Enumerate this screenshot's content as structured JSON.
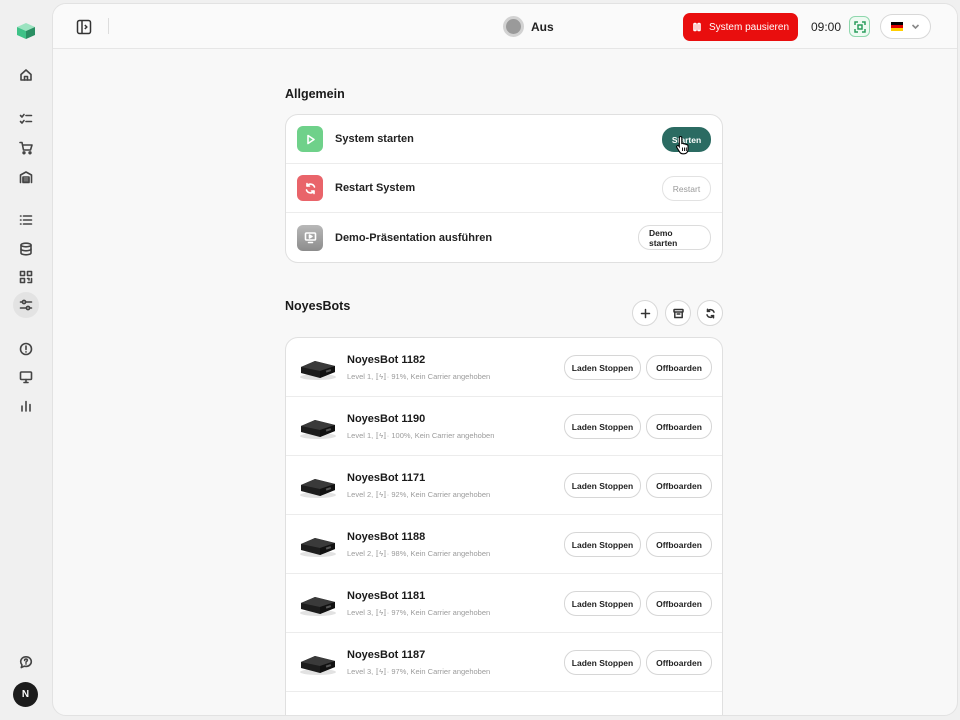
{
  "sidebar": {
    "icons": [
      "home-icon",
      "checklist-icon",
      "cart-icon",
      "warehouse-icon",
      "list-icon",
      "database-icon",
      "qr-code-icon",
      "sliders-icon",
      "alert-circle-icon",
      "monitor-icon",
      "bar-chart-icon",
      "help-icon"
    ],
    "active": "sliders-icon",
    "avatar_initial": "N"
  },
  "header": {
    "status_label": "Aus",
    "pause_button_label": "System pausieren",
    "time": "09:00",
    "language_flag": "de-flag-icon",
    "colors": {
      "pause": "#e90e0e",
      "status_dot": "#9a9a9a",
      "scan": "#2a9d5c"
    }
  },
  "general": {
    "title": "Allgemein",
    "items": [
      {
        "label": "System starten",
        "icon": "play-icon",
        "icon_color": "#6fd18a",
        "button": "Starten",
        "button_state": "primary"
      },
      {
        "label": "Restart System",
        "icon": "refresh-icon",
        "icon_color": "#e9646a",
        "button": "Restart",
        "button_state": "disabled"
      },
      {
        "label": "Demo-Präsentation ausführen",
        "icon": "presentation-icon",
        "icon_color": "#9e9e9e",
        "button": "Demo starten",
        "button_state": "default"
      }
    ]
  },
  "bots": {
    "title": "NoyesBots",
    "actions": [
      "plus-icon",
      "archive-icon",
      "refresh-icon"
    ],
    "stop_label": "Laden Stoppen",
    "offboard_label": "Offboarden",
    "items": [
      {
        "name": "NoyesBot 1182",
        "level": "Level 1,",
        "battery": "91%, Kein Carrier angehoben"
      },
      {
        "name": "NoyesBot 1190",
        "level": "Level 1,",
        "battery": "100%, Kein Carrier angehoben"
      },
      {
        "name": "NoyesBot 1171",
        "level": "Level 2,",
        "battery": "92%, Kein Carrier angehoben"
      },
      {
        "name": "NoyesBot 1188",
        "level": "Level 2,",
        "battery": "98%, Kein Carrier angehoben"
      },
      {
        "name": "NoyesBot 1181",
        "level": "Level 3,",
        "battery": "97%, Kein Carrier angehoben"
      },
      {
        "name": "NoyesBot 1187",
        "level": "Level 3,",
        "battery": "97%, Kein Carrier angehoben"
      }
    ]
  },
  "accent_color": "#2b6b62"
}
